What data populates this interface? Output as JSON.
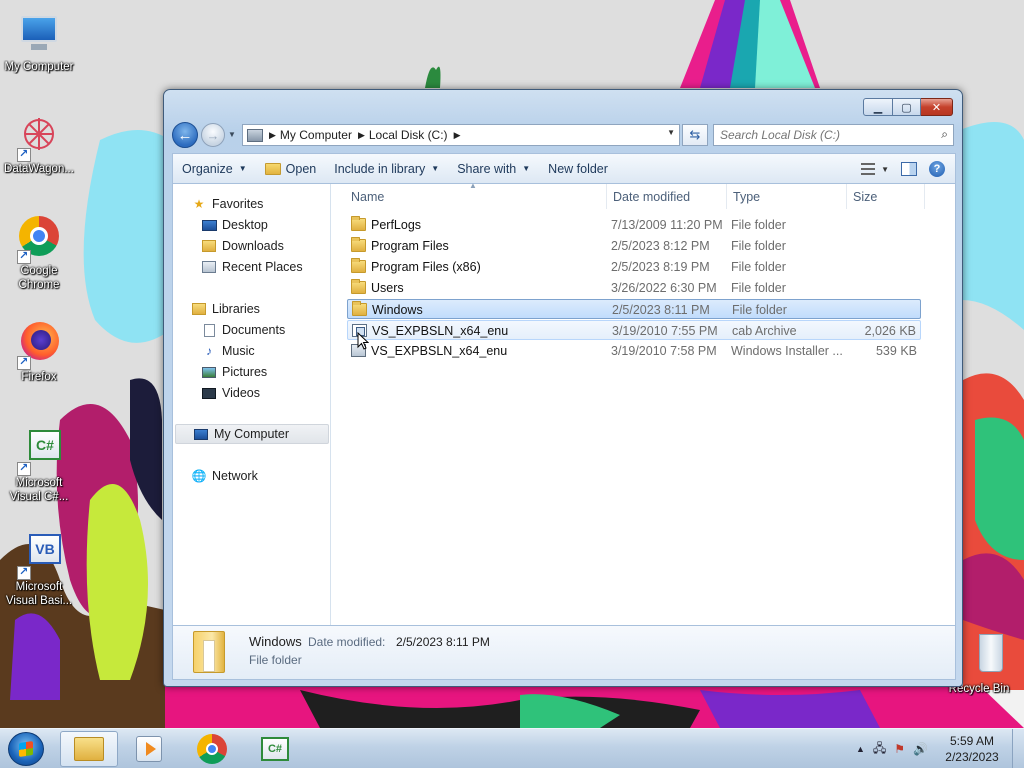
{
  "desktop": {
    "icons": [
      {
        "label": "My Computer"
      },
      {
        "label": "DataWagon..."
      },
      {
        "label": "Google Chrome"
      },
      {
        "label": "Firefox"
      },
      {
        "label": "Microsoft Visual C#..."
      },
      {
        "label": "Microsoft Visual Basi..."
      },
      {
        "label": "Recycle Bin"
      }
    ]
  },
  "window": {
    "caption": {
      "minimize": "▁",
      "maximize": "▢",
      "close": "✕"
    },
    "address": {
      "crumbs": [
        "My Computer",
        "Local Disk (C:)"
      ]
    },
    "search": {
      "placeholder": "Search Local Disk (C:)"
    },
    "toolbar": {
      "organize": "Organize",
      "open": "Open",
      "include_in_library": "Include in library",
      "share_with": "Share with",
      "new_folder": "New folder"
    },
    "nav": {
      "favorites": "Favorites",
      "desktop": "Desktop",
      "downloads": "Downloads",
      "recent_places": "Recent Places",
      "libraries": "Libraries",
      "documents": "Documents",
      "music": "Music",
      "pictures": "Pictures",
      "videos": "Videos",
      "my_computer": "My Computer",
      "network": "Network"
    },
    "columns": {
      "name": "Name",
      "date": "Date modified",
      "type": "Type",
      "size": "Size"
    },
    "files": [
      {
        "name": "PerfLogs",
        "date": "7/13/2009 11:20 PM",
        "type": "File folder",
        "size": "",
        "kind": "folder"
      },
      {
        "name": "Program Files",
        "date": "2/5/2023 8:12 PM",
        "type": "File folder",
        "size": "",
        "kind": "folder"
      },
      {
        "name": "Program Files (x86)",
        "date": "2/5/2023 8:19 PM",
        "type": "File folder",
        "size": "",
        "kind": "folder"
      },
      {
        "name": "Users",
        "date": "3/26/2022 6:30 PM",
        "type": "File folder",
        "size": "",
        "kind": "folder"
      },
      {
        "name": "Windows",
        "date": "2/5/2023 8:11 PM",
        "type": "File folder",
        "size": "",
        "kind": "folder"
      },
      {
        "name": "VS_EXPBSLN_x64_enu",
        "date": "3/19/2010 7:55 PM",
        "type": "cab Archive",
        "size": "2,026 KB",
        "kind": "cab"
      },
      {
        "name": "VS_EXPBSLN_x64_enu",
        "date": "3/19/2010 7:58 PM",
        "type": "Windows Installer ...",
        "size": "539 KB",
        "kind": "msi"
      }
    ],
    "details": {
      "name": "Windows",
      "date_label": "Date modified:",
      "date_value": "2/5/2023 8:11 PM",
      "type": "File folder"
    }
  },
  "taskbar": {
    "clock_time": "5:59 AM",
    "clock_date": "2/23/2023",
    "tray_expand": "▲",
    "csharp_label": "C#"
  }
}
